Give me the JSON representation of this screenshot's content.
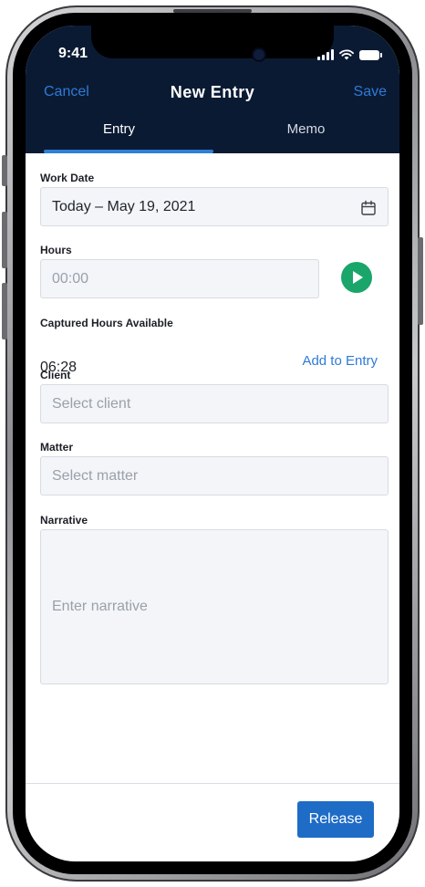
{
  "status_bar": {
    "time": "9:41"
  },
  "nav": {
    "cancel_label": "Cancel",
    "title": "New Entry",
    "save_label": "Save"
  },
  "tabs": [
    {
      "label": "Entry",
      "active": true
    },
    {
      "label": "Memo",
      "active": false
    }
  ],
  "form": {
    "work_date": {
      "label": "Work Date",
      "value": "Today – May 19, 2021"
    },
    "hours": {
      "label": "Hours",
      "placeholder": "00:00"
    },
    "captured": {
      "label": "Captured Hours Available",
      "value": "06:28",
      "action_label": "Add to Entry"
    },
    "client": {
      "label": "Client",
      "placeholder": "Select client"
    },
    "matter": {
      "label": "Matter",
      "placeholder": "Select matter"
    },
    "narrative": {
      "label": "Narrative",
      "placeholder": "Enter narrative"
    }
  },
  "footer": {
    "release_label": "Release"
  },
  "colors": {
    "header_bg": "#0b1a33",
    "accent_blue": "#2e7bd6",
    "play_green": "#1aa56a",
    "release_bg": "#1f6cc7"
  },
  "icons": [
    "calendar-icon",
    "play-icon",
    "signal-icon",
    "wifi-icon",
    "battery-icon"
  ]
}
